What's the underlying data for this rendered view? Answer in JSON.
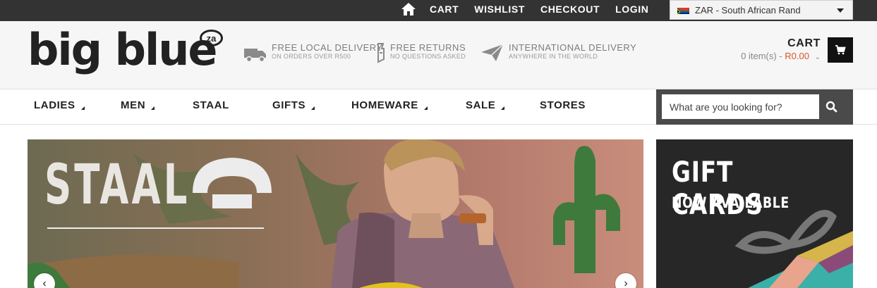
{
  "topbar": {
    "links": [
      "CART",
      "WISHLIST",
      "CHECKOUT",
      "LOGIN"
    ],
    "currency": "ZAR - South African Rand"
  },
  "logo": {
    "text": "big blue",
    "badge": "za"
  },
  "features": [
    {
      "title": "FREE LOCAL DELIVERY",
      "sub": "ON ORDERS OVER R500",
      "icon": "truck-icon"
    },
    {
      "title": "FREE RETURNS",
      "sub": "NO QUESTIONS ASKED",
      "icon": "returns-icon"
    },
    {
      "title": "INTERNATIONAL DELIVERY",
      "sub": "ANYWHERE IN THE WORLD",
      "icon": "paper-plane-icon"
    }
  ],
  "cart": {
    "label": "CART",
    "items_text": "0 item(s) - ",
    "amount": "R0.00"
  },
  "nav": {
    "items": [
      {
        "label": "LADIES"
      },
      {
        "label": "MEN"
      },
      {
        "label": "STAAL"
      },
      {
        "label": "GIFTS"
      },
      {
        "label": "HOMEWARE"
      },
      {
        "label": "SALE"
      },
      {
        "label": "STORES"
      }
    ]
  },
  "search": {
    "placeholder": "What are you looking for?"
  },
  "banner": {
    "title": "STAAL"
  },
  "gift_cards": {
    "title": "GIFT CARDS",
    "subtitle": "NOW AVAILABLE"
  },
  "colors": {
    "topbar": "#333333",
    "accent_price": "#d5572d",
    "search_bg": "#4a4a4a"
  }
}
